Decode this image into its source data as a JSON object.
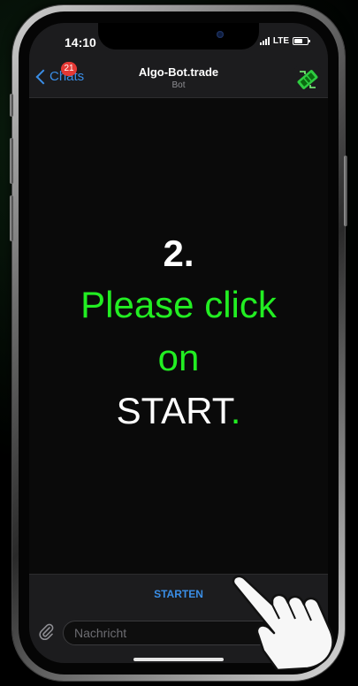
{
  "status_bar": {
    "time": "14:10",
    "network": "LTE"
  },
  "nav": {
    "back_label": "Chats",
    "unread_badge": "21",
    "title": "Algo-Bot.trade",
    "subtitle": "Bot",
    "avatar_icon": "algo-bot-logo-icon"
  },
  "message": {
    "step": "2.",
    "line1": "Please click",
    "line2": "on",
    "line3": "START",
    "line3_suffix": "."
  },
  "start_button": {
    "label": "STARTEN"
  },
  "composer": {
    "placeholder": "Nachricht",
    "value": ""
  },
  "colors": {
    "accent_blue": "#3a8ee6",
    "highlight_green": "#22ee22",
    "badge_red": "#e53935",
    "bar_bg": "#1c1c1e"
  },
  "icons": {
    "back": "chevron-left-icon",
    "attach": "paperclip-icon",
    "pointer": "hand-pointer-icon"
  }
}
